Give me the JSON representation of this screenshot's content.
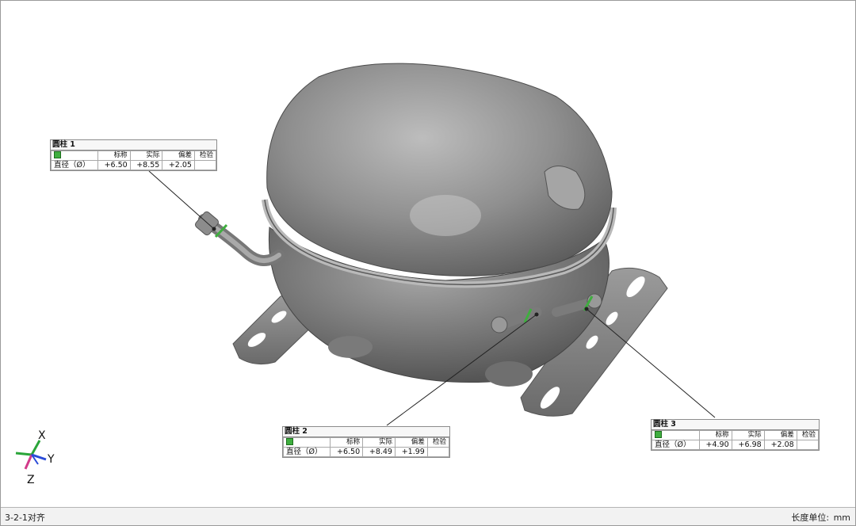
{
  "callouts": [
    {
      "title": "圆柱 1",
      "headers": [
        "标称",
        "实际",
        "偏差",
        "检验"
      ],
      "row_label": "直径（Ø）",
      "nominal": "+6.50",
      "actual": "+8.55",
      "deviation": "+2.05",
      "check": ""
    },
    {
      "title": "圆柱 2",
      "headers": [
        "标称",
        "实际",
        "偏差",
        "检验"
      ],
      "row_label": "直径（Ø）",
      "nominal": "+6.50",
      "actual": "+8.49",
      "deviation": "+1.99",
      "check": ""
    },
    {
      "title": "圆柱 3",
      "headers": [
        "标称",
        "实际",
        "偏差",
        "检验"
      ],
      "row_label": "直径（Ø）",
      "nominal": "+4.90",
      "actual": "+6.98",
      "deviation": "+2.08",
      "check": ""
    }
  ],
  "axes": {
    "x": "X",
    "y": "Y",
    "z": "Z"
  },
  "status": {
    "alignment": "3-2-1对齐",
    "unit_label": "长度单位:",
    "unit": "mm"
  },
  "colors": {
    "model": "#8e8e8e",
    "check_ok": "#3fae3f",
    "axis_x": "#2aa53a",
    "axis_y": "#2a4bd8",
    "axis_z": "#d23a8a"
  },
  "icons": {
    "check": "check-square-icon"
  }
}
